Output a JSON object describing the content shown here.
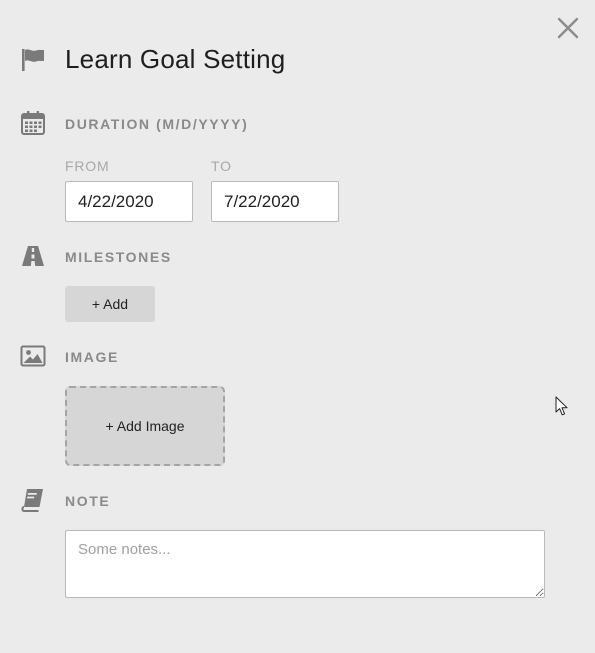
{
  "goal": {
    "title": "Learn Goal Setting"
  },
  "duration": {
    "label": "DURATION (M/D/YYYY)",
    "from_label": "FROM",
    "from_value": "4/22/2020",
    "to_label": "TO",
    "to_value": "7/22/2020"
  },
  "milestones": {
    "label": "MILESTONES",
    "add_label": "+ Add"
  },
  "image": {
    "label": "IMAGE",
    "add_label": "+ Add Image"
  },
  "note": {
    "label": "NOTE",
    "value": "",
    "placeholder": "Some notes..."
  },
  "icons": {
    "close": "close-icon",
    "title": "flag-icon",
    "duration": "calendar-icon",
    "milestones": "road-icon",
    "image": "image-icon",
    "note": "book-icon"
  },
  "colors": {
    "background": "#ebebeb",
    "label": "#8a8a8a",
    "button": "#d6d6d6",
    "icon": "#777777"
  }
}
